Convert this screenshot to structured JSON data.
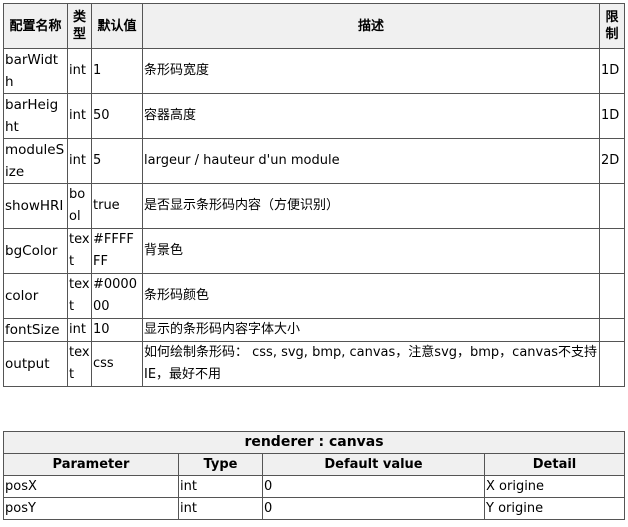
{
  "config_table": {
    "headers": [
      "配置名称",
      "类型",
      "默认值",
      "描述",
      "限制"
    ],
    "rows": [
      [
        "barWidth",
        "int",
        "1",
        "条形码宽度",
        "1D"
      ],
      [
        "barHeight",
        "int",
        "50",
        "容器高度",
        "1D"
      ],
      [
        "moduleSize",
        "int",
        "5",
        "largeur / hauteur d'un module",
        "2D"
      ],
      [
        "showHRI",
        "bool",
        "true",
        "是否显示条形码内容（方便识别）",
        ""
      ],
      [
        "bgColor",
        "text",
        "#FFFFFF",
        "背景色",
        ""
      ],
      [
        "color",
        "text",
        "#000000",
        "条形码颜色",
        ""
      ],
      [
        "fontSize",
        "int",
        "10",
        "显示的条形码内容字体大小",
        ""
      ],
      [
        "output",
        "text",
        "css",
        "如何绘制条形码： css, svg, bmp, canvas，注意svg，bmp，canvas不支持IE，最好不用",
        ""
      ]
    ]
  },
  "renderer_table": {
    "caption": "renderer : canvas",
    "headers": [
      "Parameter",
      "Type",
      "Default value",
      "Detail"
    ],
    "rows": [
      [
        "posX",
        "int",
        "0",
        "X origine"
      ],
      [
        "posY",
        "int",
        "0",
        "Y origine"
      ]
    ]
  }
}
